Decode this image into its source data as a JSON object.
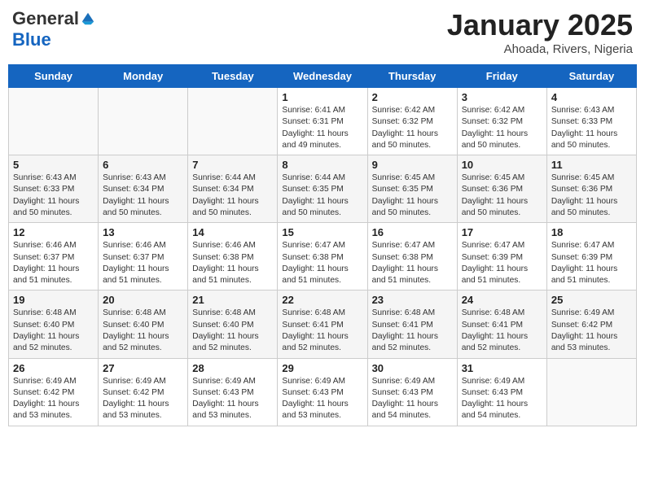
{
  "header": {
    "logo_general": "General",
    "logo_blue": "Blue",
    "title": "January 2025",
    "location": "Ahoada, Rivers, Nigeria"
  },
  "days_of_week": [
    "Sunday",
    "Monday",
    "Tuesday",
    "Wednesday",
    "Thursday",
    "Friday",
    "Saturday"
  ],
  "weeks": [
    [
      {
        "day": "",
        "info": ""
      },
      {
        "day": "",
        "info": ""
      },
      {
        "day": "",
        "info": ""
      },
      {
        "day": "1",
        "info": "Sunrise: 6:41 AM\nSunset: 6:31 PM\nDaylight: 11 hours and 49 minutes."
      },
      {
        "day": "2",
        "info": "Sunrise: 6:42 AM\nSunset: 6:32 PM\nDaylight: 11 hours and 50 minutes."
      },
      {
        "day": "3",
        "info": "Sunrise: 6:42 AM\nSunset: 6:32 PM\nDaylight: 11 hours and 50 minutes."
      },
      {
        "day": "4",
        "info": "Sunrise: 6:43 AM\nSunset: 6:33 PM\nDaylight: 11 hours and 50 minutes."
      }
    ],
    [
      {
        "day": "5",
        "info": "Sunrise: 6:43 AM\nSunset: 6:33 PM\nDaylight: 11 hours and 50 minutes."
      },
      {
        "day": "6",
        "info": "Sunrise: 6:43 AM\nSunset: 6:34 PM\nDaylight: 11 hours and 50 minutes."
      },
      {
        "day": "7",
        "info": "Sunrise: 6:44 AM\nSunset: 6:34 PM\nDaylight: 11 hours and 50 minutes."
      },
      {
        "day": "8",
        "info": "Sunrise: 6:44 AM\nSunset: 6:35 PM\nDaylight: 11 hours and 50 minutes."
      },
      {
        "day": "9",
        "info": "Sunrise: 6:45 AM\nSunset: 6:35 PM\nDaylight: 11 hours and 50 minutes."
      },
      {
        "day": "10",
        "info": "Sunrise: 6:45 AM\nSunset: 6:36 PM\nDaylight: 11 hours and 50 minutes."
      },
      {
        "day": "11",
        "info": "Sunrise: 6:45 AM\nSunset: 6:36 PM\nDaylight: 11 hours and 50 minutes."
      }
    ],
    [
      {
        "day": "12",
        "info": "Sunrise: 6:46 AM\nSunset: 6:37 PM\nDaylight: 11 hours and 51 minutes."
      },
      {
        "day": "13",
        "info": "Sunrise: 6:46 AM\nSunset: 6:37 PM\nDaylight: 11 hours and 51 minutes."
      },
      {
        "day": "14",
        "info": "Sunrise: 6:46 AM\nSunset: 6:38 PM\nDaylight: 11 hours and 51 minutes."
      },
      {
        "day": "15",
        "info": "Sunrise: 6:47 AM\nSunset: 6:38 PM\nDaylight: 11 hours and 51 minutes."
      },
      {
        "day": "16",
        "info": "Sunrise: 6:47 AM\nSunset: 6:38 PM\nDaylight: 11 hours and 51 minutes."
      },
      {
        "day": "17",
        "info": "Sunrise: 6:47 AM\nSunset: 6:39 PM\nDaylight: 11 hours and 51 minutes."
      },
      {
        "day": "18",
        "info": "Sunrise: 6:47 AM\nSunset: 6:39 PM\nDaylight: 11 hours and 51 minutes."
      }
    ],
    [
      {
        "day": "19",
        "info": "Sunrise: 6:48 AM\nSunset: 6:40 PM\nDaylight: 11 hours and 52 minutes."
      },
      {
        "day": "20",
        "info": "Sunrise: 6:48 AM\nSunset: 6:40 PM\nDaylight: 11 hours and 52 minutes."
      },
      {
        "day": "21",
        "info": "Sunrise: 6:48 AM\nSunset: 6:40 PM\nDaylight: 11 hours and 52 minutes."
      },
      {
        "day": "22",
        "info": "Sunrise: 6:48 AM\nSunset: 6:41 PM\nDaylight: 11 hours and 52 minutes."
      },
      {
        "day": "23",
        "info": "Sunrise: 6:48 AM\nSunset: 6:41 PM\nDaylight: 11 hours and 52 minutes."
      },
      {
        "day": "24",
        "info": "Sunrise: 6:48 AM\nSunset: 6:41 PM\nDaylight: 11 hours and 52 minutes."
      },
      {
        "day": "25",
        "info": "Sunrise: 6:49 AM\nSunset: 6:42 PM\nDaylight: 11 hours and 53 minutes."
      }
    ],
    [
      {
        "day": "26",
        "info": "Sunrise: 6:49 AM\nSunset: 6:42 PM\nDaylight: 11 hours and 53 minutes."
      },
      {
        "day": "27",
        "info": "Sunrise: 6:49 AM\nSunset: 6:42 PM\nDaylight: 11 hours and 53 minutes."
      },
      {
        "day": "28",
        "info": "Sunrise: 6:49 AM\nSunset: 6:43 PM\nDaylight: 11 hours and 53 minutes."
      },
      {
        "day": "29",
        "info": "Sunrise: 6:49 AM\nSunset: 6:43 PM\nDaylight: 11 hours and 53 minutes."
      },
      {
        "day": "30",
        "info": "Sunrise: 6:49 AM\nSunset: 6:43 PM\nDaylight: 11 hours and 54 minutes."
      },
      {
        "day": "31",
        "info": "Sunrise: 6:49 AM\nSunset: 6:43 PM\nDaylight: 11 hours and 54 minutes."
      },
      {
        "day": "",
        "info": ""
      }
    ]
  ]
}
